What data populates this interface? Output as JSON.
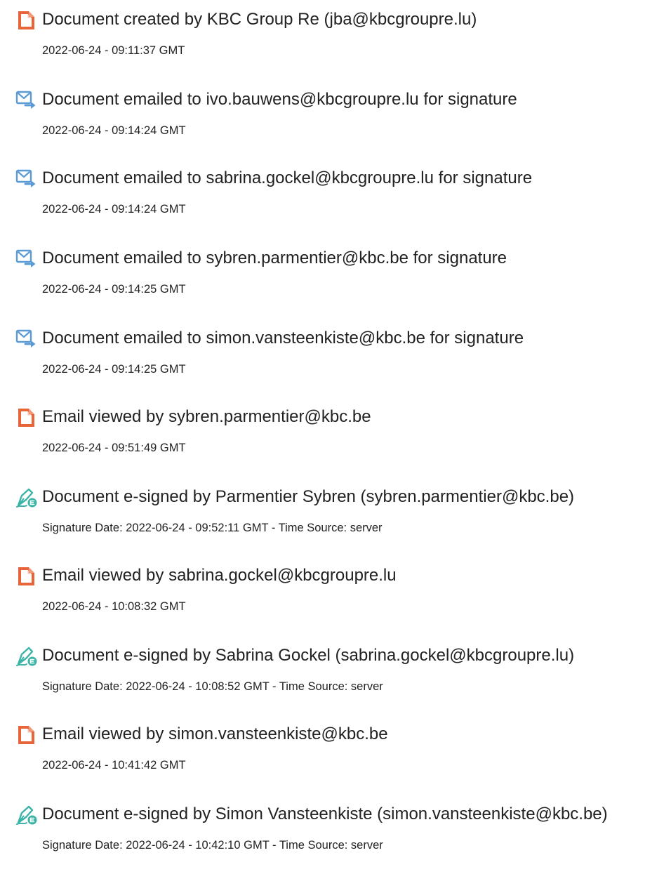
{
  "events": [
    {
      "icon": "document-icon",
      "title": "Document created by KBC Group Re (jba@kbcgroupre.lu)",
      "detail": "2022-06-24 - 09:11:37 GMT"
    },
    {
      "icon": "email-sent-icon",
      "title": "Document emailed to ivo.bauwens@kbcgroupre.lu for signature",
      "detail": "2022-06-24 - 09:14:24 GMT"
    },
    {
      "icon": "email-sent-icon",
      "title": "Document emailed to sabrina.gockel@kbcgroupre.lu for signature",
      "detail": "2022-06-24 - 09:14:24 GMT"
    },
    {
      "icon": "email-sent-icon",
      "title": "Document emailed to sybren.parmentier@kbc.be for signature",
      "detail": "2022-06-24 - 09:14:25 GMT"
    },
    {
      "icon": "email-sent-icon",
      "title": "Document emailed to simon.vansteenkiste@kbc.be for signature",
      "detail": "2022-06-24 - 09:14:25 GMT"
    },
    {
      "icon": "document-icon",
      "title": "Email viewed by sybren.parmentier@kbc.be",
      "detail": "2022-06-24 - 09:51:49 GMT"
    },
    {
      "icon": "e-sign-icon",
      "title": "Document e-signed by Parmentier Sybren (sybren.parmentier@kbc.be)",
      "detail": "Signature Date: 2022-06-24 - 09:52:11 GMT - Time Source: server"
    },
    {
      "icon": "document-icon",
      "title": "Email viewed by sabrina.gockel@kbcgroupre.lu",
      "detail": "2022-06-24 - 10:08:32 GMT"
    },
    {
      "icon": "e-sign-icon",
      "title": "Document e-signed by Sabrina Gockel (sabrina.gockel@kbcgroupre.lu)",
      "detail": "Signature Date: 2022-06-24 - 10:08:52 GMT - Time Source: server"
    },
    {
      "icon": "document-icon",
      "title": "Email viewed by simon.vansteenkiste@kbc.be",
      "detail": "2022-06-24 - 10:41:42 GMT"
    },
    {
      "icon": "e-sign-icon",
      "title": "Document e-signed by Simon Vansteenkiste (simon.vansteenkiste@kbc.be)",
      "detail": "Signature Date: 2022-06-24 - 10:42:10 GMT - Time Source: server"
    }
  ],
  "colors": {
    "document_icon": "#e8643a",
    "email_icon": "#5b9bd5",
    "esign_icon": "#3bb3a6",
    "text": "#222222"
  }
}
